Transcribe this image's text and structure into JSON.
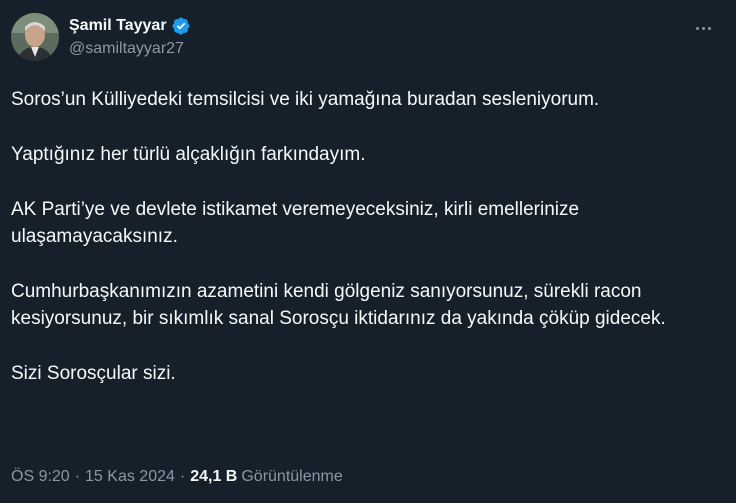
{
  "author": {
    "display_name": "Şamil Tayyar",
    "handle": "@samiltayyar27",
    "verified": true
  },
  "icons": {
    "avatar": "profile-photo",
    "verified": "verified-badge-icon",
    "more": "more-options-icon"
  },
  "colors": {
    "background": "#15202b",
    "text": "#f7f9f9",
    "secondary": "#8b98a5",
    "verified_badge": "#1d9bf0"
  },
  "tweet": {
    "paragraphs": [
      "Soros’un Külliyedeki temsilcisi ve iki yamağına buradan sesleniyorum.",
      "Yaptığınız her türlü alçaklığın farkındayım.",
      "AK Parti’ye ve devlete istikamet veremeyeceksiniz, kirli emellerinize ulaşamayacaksınız.",
      "Cumhurbaşkanımızın azametini kendi gölgeniz sanıyorsunuz, sürekli racon kesiyorsunuz, bir sıkımlık sanal Sorosçu iktidarınız da yakında çöküp gidecek.",
      "Sizi Sorosçular sizi."
    ]
  },
  "meta": {
    "time": "ÖS 9:20",
    "separator": "·",
    "date": "15 Kas 2024",
    "views_count": "24,1 B",
    "views_label": "Görüntülenme"
  }
}
